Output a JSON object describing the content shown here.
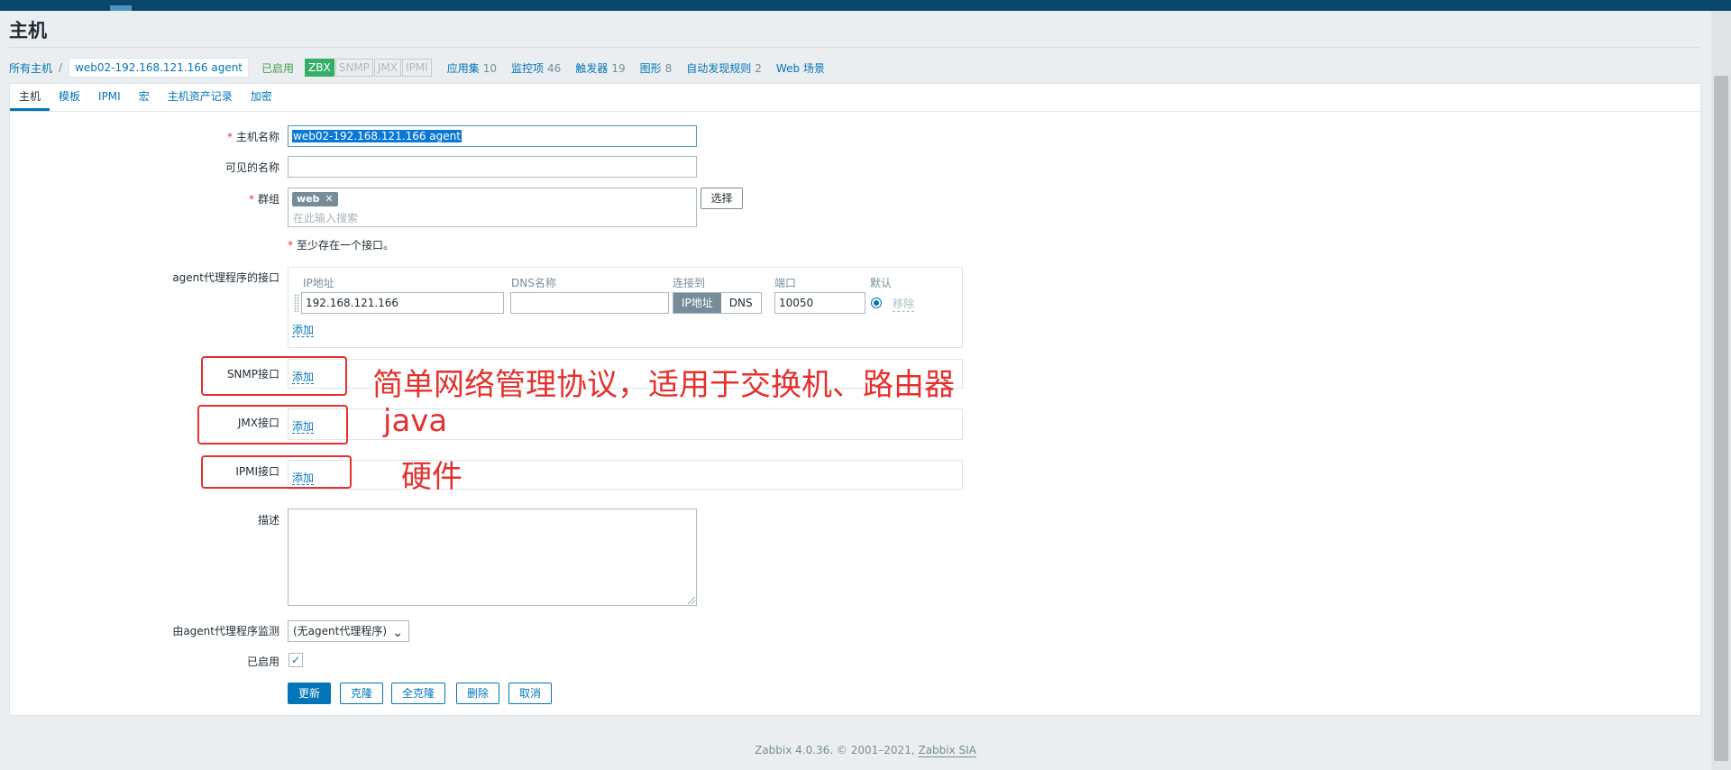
{
  "page": {
    "title": "主机"
  },
  "nav": {
    "all_hosts": "所有主机",
    "separator": "/",
    "current_host": "web02-192.168.121.166 agent",
    "status": "已启用",
    "badges": [
      "ZBX",
      "SNMP",
      "JMX",
      "IPMI"
    ],
    "links": [
      {
        "label": "应用集",
        "count": "10"
      },
      {
        "label": "监控项",
        "count": "46"
      },
      {
        "label": "触发器",
        "count": "19"
      },
      {
        "label": "图形",
        "count": "8"
      },
      {
        "label": "自动发现规则",
        "count": "2"
      },
      {
        "label": "Web 场景",
        "count": ""
      }
    ]
  },
  "tabs": [
    "主机",
    "模板",
    "IPMI",
    "宏",
    "主机资产记录",
    "加密"
  ],
  "form": {
    "host_name_label": "主机名称",
    "host_name_value": "web02-192.168.121.166 agent",
    "visible_name_label": "可见的名称",
    "visible_name_value": "",
    "groups_label": "群组",
    "group_chip": "web",
    "groups_placeholder": "在此输入搜索",
    "select_button": "选择",
    "required_hint": "至少存在一个接口。",
    "agent_iface_label": "agent代理程序的接口",
    "iface_headers": {
      "ip": "IP地址",
      "dns": "DNS名称",
      "connect": "连接到",
      "port": "端口",
      "default": "默认"
    },
    "iface_row": {
      "ip": "192.168.121.166",
      "dns": "",
      "connect_ip": "IP地址",
      "connect_dns": "DNS",
      "port": "10050",
      "remove": "移除"
    },
    "add_link": "添加",
    "snmp_label": "SNMP接口",
    "jmx_label": "JMX接口",
    "ipmi_label": "IPMI接口",
    "description_label": "描述",
    "description_value": "",
    "proxy_label": "由agent代理程序监测",
    "proxy_value": "(无agent代理程序)",
    "enabled_label": "已启用",
    "enabled_checked": true,
    "buttons": {
      "update": "更新",
      "clone": "克隆",
      "full_clone": "全克隆",
      "delete": "删除",
      "cancel": "取消"
    }
  },
  "annotations": {
    "snmp": "简单网络管理协议，适用于交换机、路由器",
    "jmx": "java",
    "ipmi": "硬件"
  },
  "footer": {
    "text": "Zabbix 4.0.36. © 2001–2021,",
    "company": "Zabbix SIA"
  },
  "colors": {
    "primary": "#0275b8",
    "enabled": "#429e47",
    "zbx_badge": "#34af67",
    "annotation_red": "#e3312e",
    "topbar": "#0a466a"
  }
}
